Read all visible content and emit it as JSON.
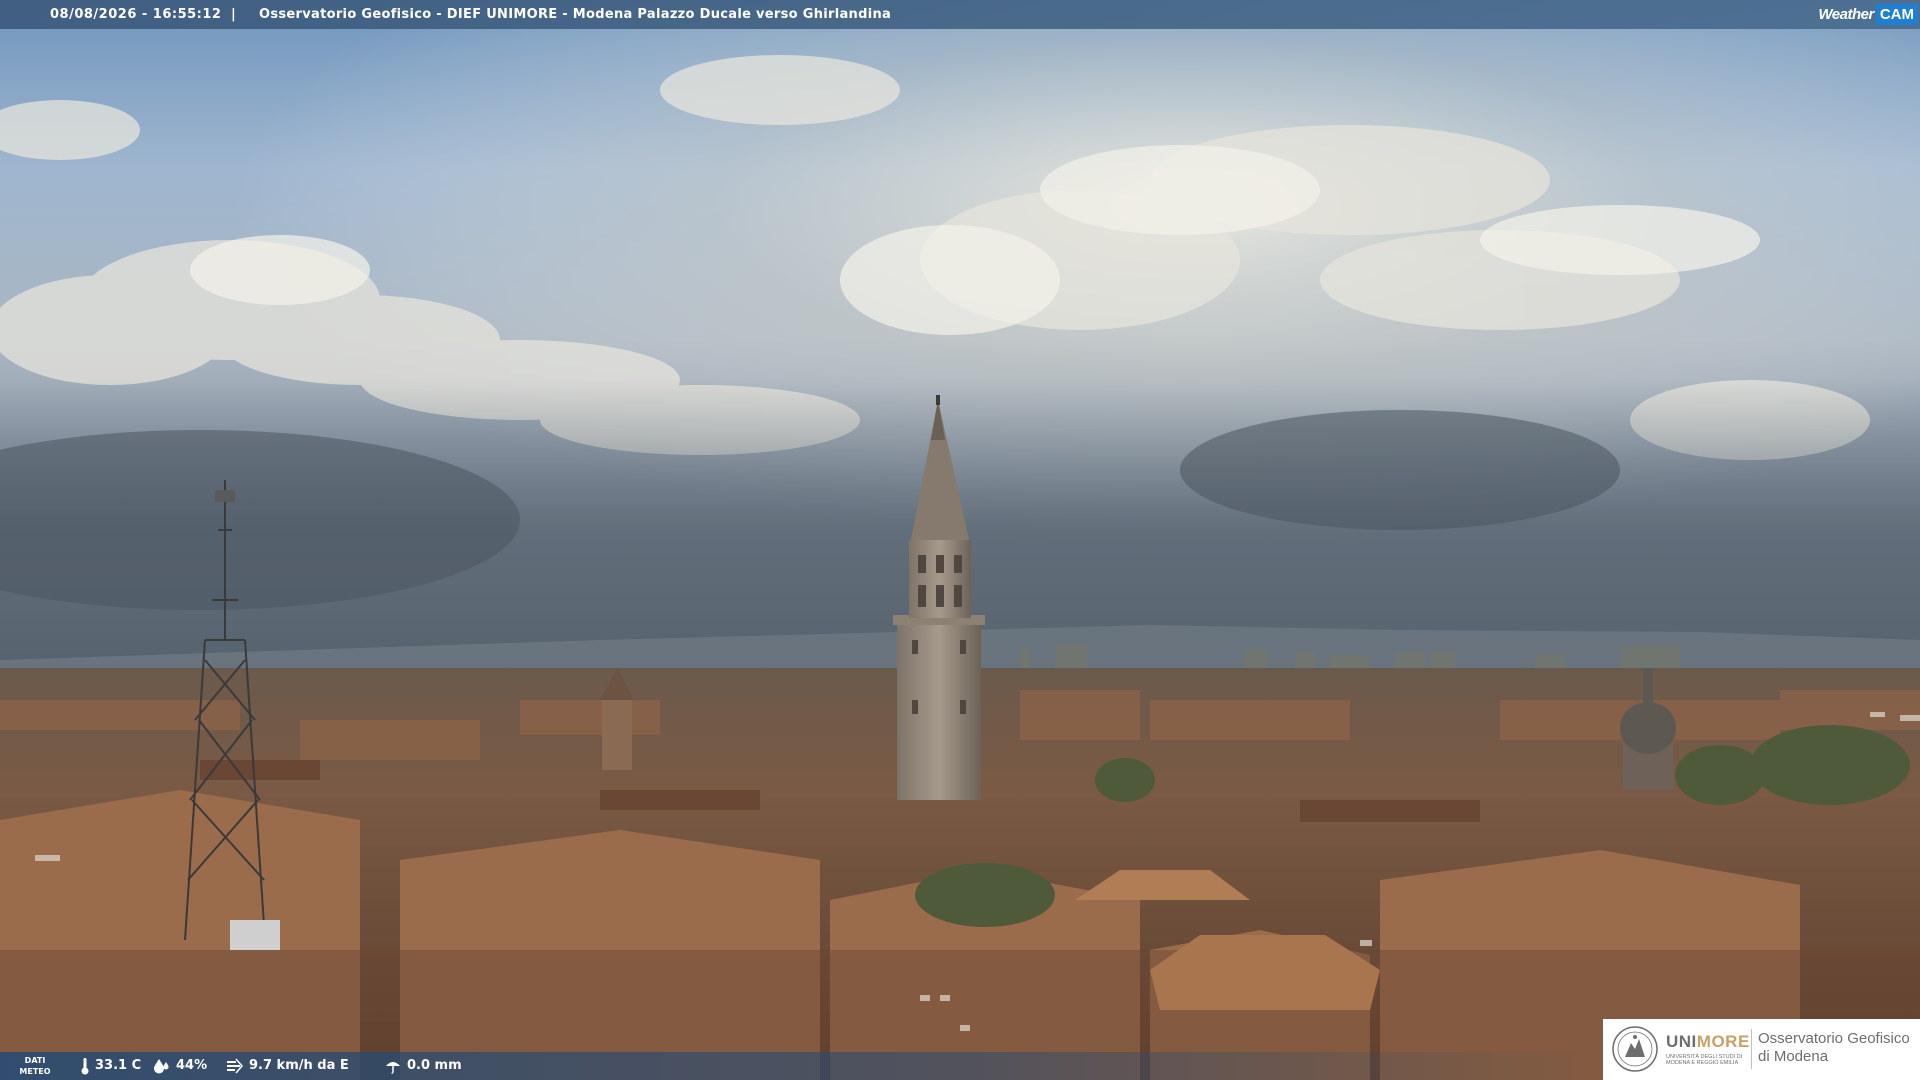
{
  "topbar": {
    "timestamp": "08/08/2026 - 16:55:12",
    "separator": "|",
    "title": "Osservatorio Geofisico - DIEF UNIMORE - Modena Palazzo Ducale verso Ghirlandina"
  },
  "brand": {
    "weather": "Weather",
    "cam": "CAM",
    "accent": "#1f7fd1"
  },
  "weather_data": {
    "label_line1": "DATI",
    "label_line2": "METEO",
    "temperature": "33.1 C",
    "humidity": "44%",
    "wind": "9.7 km/h da E",
    "rain": "0.0 mm",
    "icons": [
      "thermometer-icon",
      "humidity-drop-icon",
      "wind-icon",
      "rain-icon"
    ]
  },
  "logo": {
    "uni": "UNI",
    "more": "MORE",
    "subtitle_line1": "UNIVERSITÀ DEGLI STUDI DI",
    "subtitle_line2": "MODENA E REGGIO EMILIA",
    "observatory_line1": "Osservatorio Geofisico",
    "observatory_line2": "di Modena"
  }
}
